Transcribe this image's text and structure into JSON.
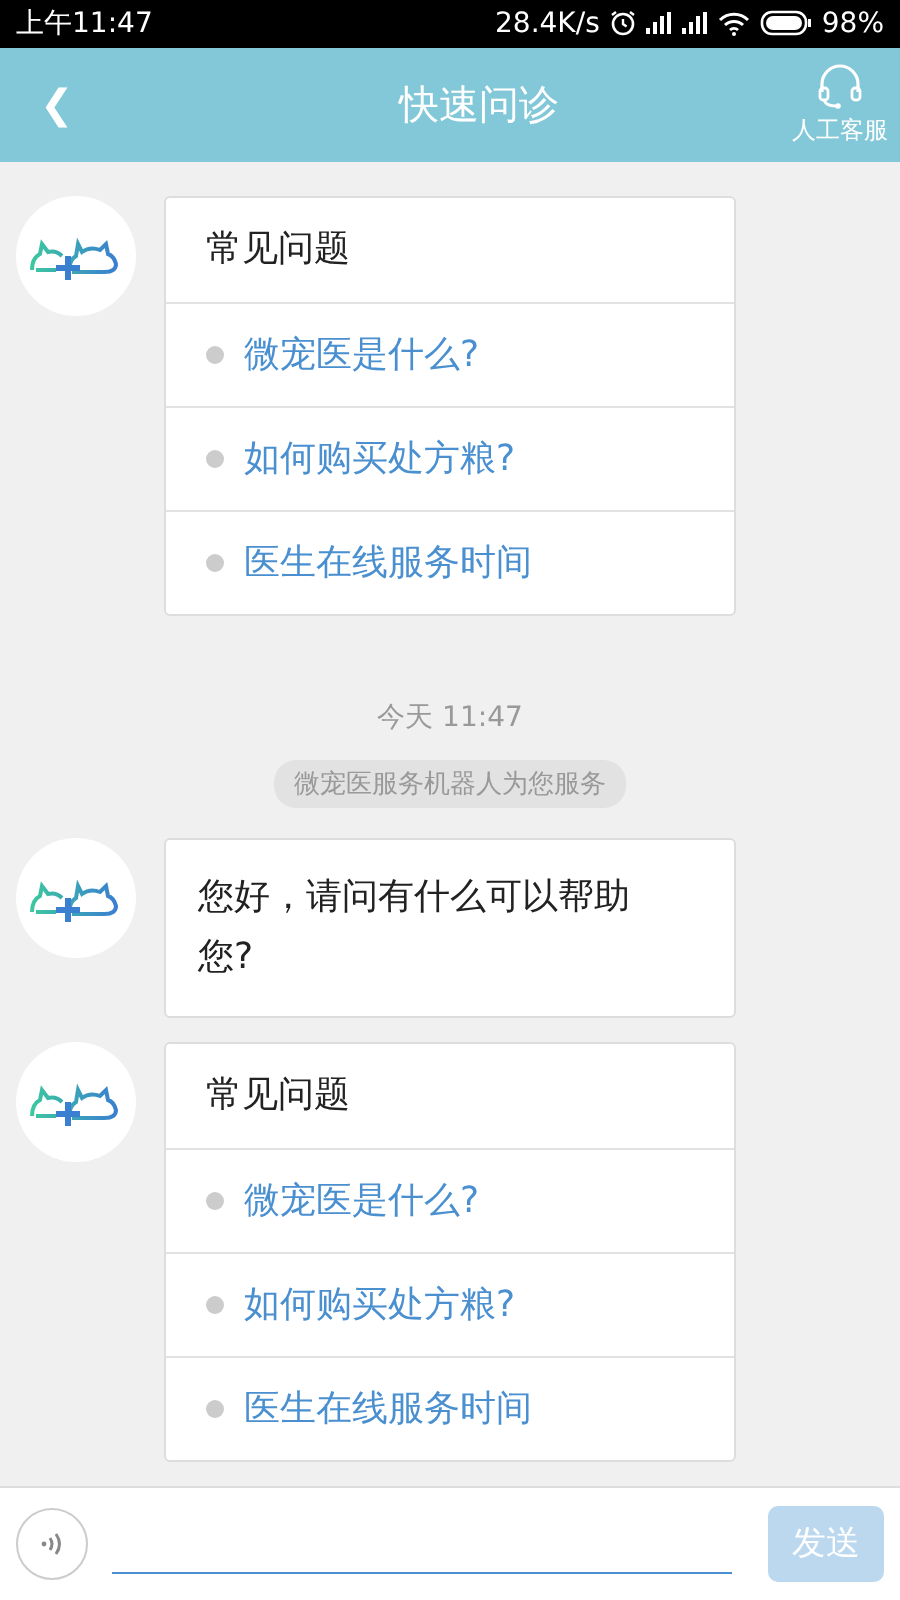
{
  "status_bar": {
    "time": "上午11:47",
    "speed": "28.4K/s",
    "battery": "98%"
  },
  "header": {
    "back": "❮",
    "title": "快速问诊",
    "service_label": "人工客服"
  },
  "messages": [
    {
      "kind": "faq",
      "title": "常见问题",
      "items": [
        "微宠医是什么?",
        "如何购买处方粮?",
        "医生在线服务时间"
      ]
    },
    {
      "kind": "time",
      "text": "今天 11:47"
    },
    {
      "kind": "notice",
      "text": "微宠医服务机器人为您服务"
    },
    {
      "kind": "text",
      "text": "您好，请问有什么可以帮助您?"
    },
    {
      "kind": "faq",
      "title": "常见问题",
      "items": [
        "微宠医是什么?",
        "如何购买处方粮?",
        "医生在线服务时间"
      ]
    }
  ],
  "composer": {
    "send_label": "发送",
    "send_disabled": true
  }
}
